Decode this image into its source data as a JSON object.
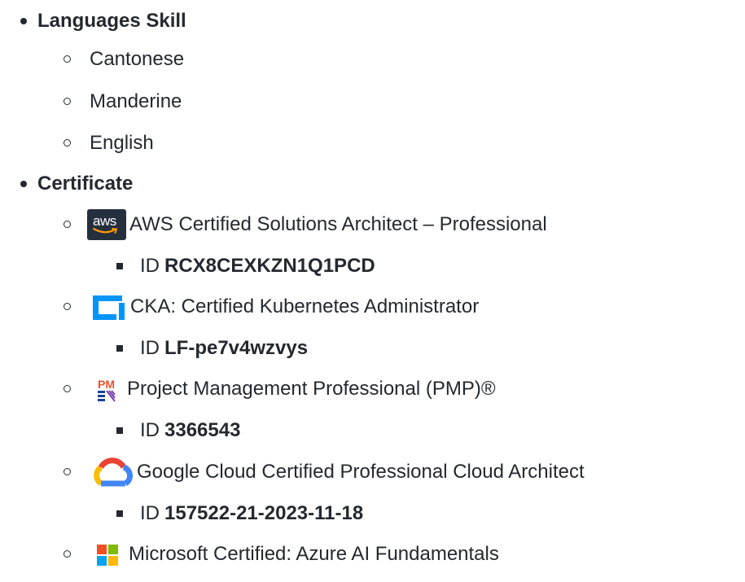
{
  "sections": [
    {
      "title": "Languages Skill",
      "items": [
        {
          "label": "Cantonese"
        },
        {
          "label": "Manderine"
        },
        {
          "label": "English"
        }
      ]
    },
    {
      "title": "Certificate",
      "items": [
        {
          "label": "AWS Certified Solutions Architect – Professional",
          "icon": "aws-logo-icon",
          "icon_text": "aws",
          "id_prefix": "ID",
          "id_value": "RCX8CEXKZN1Q1PCD"
        },
        {
          "label": "CKA: Certified Kubernetes Administrator",
          "icon": "linux-foundation-logo-icon",
          "id_prefix": "ID",
          "id_value": "LF-pe7v4wzvys"
        },
        {
          "label": "Project Management Professional (PMP)®",
          "icon": "pmi-logo-icon",
          "icon_text": "PM",
          "id_prefix": "ID",
          "id_value": "3366543"
        },
        {
          "label": "Google Cloud Certified Professional Cloud Architect",
          "icon": "google-cloud-logo-icon",
          "id_prefix": "ID",
          "id_value": "157522-21-2023-11-18"
        },
        {
          "label": "Microsoft Certified: Azure AI Fundamentals",
          "icon": "microsoft-logo-icon"
        }
      ]
    }
  ],
  "colors": {
    "text": "#24292f",
    "aws_bg": "#252f3e",
    "aws_smile": "#ff9900",
    "lf_blue": "#0094ff",
    "google_blue": "#4285f4",
    "google_red": "#ea4335",
    "google_yellow": "#fbbc04",
    "google_green": "#34a853",
    "ms_red": "#f25022",
    "ms_green": "#7fba00",
    "ms_blue": "#00a4ef",
    "ms_yellow": "#ffb900"
  }
}
